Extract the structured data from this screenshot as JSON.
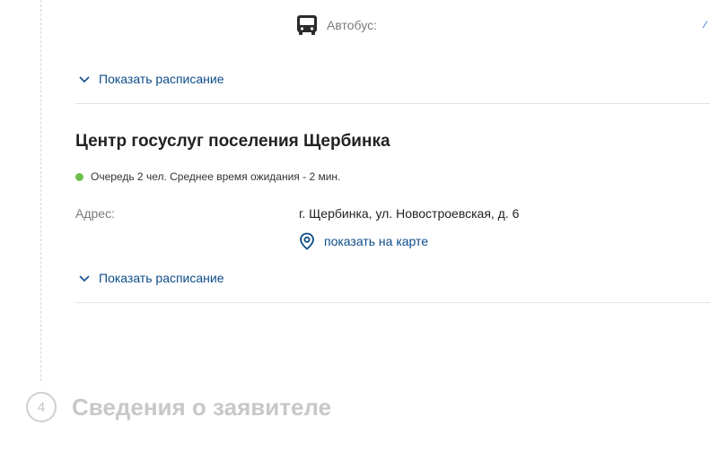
{
  "transport": {
    "bus_label": "Автобус:",
    "icon": "bus-icon",
    "edge_glyph": "⁄"
  },
  "schedule_toggle_1": {
    "label": "Показать расписание",
    "icon": "chevron-down-icon"
  },
  "center": {
    "title": "Центр госуслуг поселения Щербинка",
    "queue_status_color": "#6cc04a",
    "queue_text": "Очередь 2 чел. Среднее время ожидания - 2 мин.",
    "address_label": "Адрес:",
    "address_value": "г. Щербинка, ул. Новостроевская, д. 6",
    "map_link_label": "показать на карте",
    "map_icon": "map-pin-icon"
  },
  "schedule_toggle_2": {
    "label": "Показать расписание",
    "icon": "chevron-down-icon"
  },
  "step": {
    "number": "4",
    "title": "Сведения о заявителе"
  },
  "colors": {
    "link": "#0d4c8a",
    "muted": "#7a7a7a",
    "disabled": "#c8c8c8"
  }
}
